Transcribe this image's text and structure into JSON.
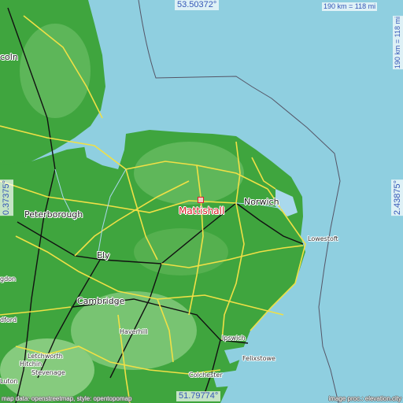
{
  "map": {
    "colors": {
      "sea": "#8fcfe0",
      "land": "#3fa53e",
      "land_light": "#78c472",
      "roads": "#f0e046",
      "rivers": "#a9d8ec"
    },
    "coords": {
      "top": "53.50372°",
      "bottom": "51.79774°",
      "left": "0.37375°",
      "right": "2.43875°"
    },
    "scale": {
      "horizontal": "190 km = 118 mi",
      "vertical": "190 km = 118 mi"
    },
    "focus": {
      "name": "Mattishall"
    },
    "places": {
      "lincoln": "coln",
      "norwich": "Norwich",
      "peterborough": "Peterborough",
      "ely": "Ely",
      "cambridge": "Cambridge",
      "lowestoft": "Lowestoft",
      "haverhill": "Haverhill",
      "ipswich": "Ipswich",
      "felixstowe": "Felixstowe",
      "colchester": "Colchester",
      "letchworth": "Letchworth",
      "hitchin": "Hitchin",
      "stevenage": "Stevenage",
      "luton": "Luton",
      "bedford": "dford",
      "hunts": "gdon"
    },
    "attribution": {
      "left": "map data: openstreetmap, style: opentopomap",
      "right": "image proc.: elevation.city"
    }
  }
}
